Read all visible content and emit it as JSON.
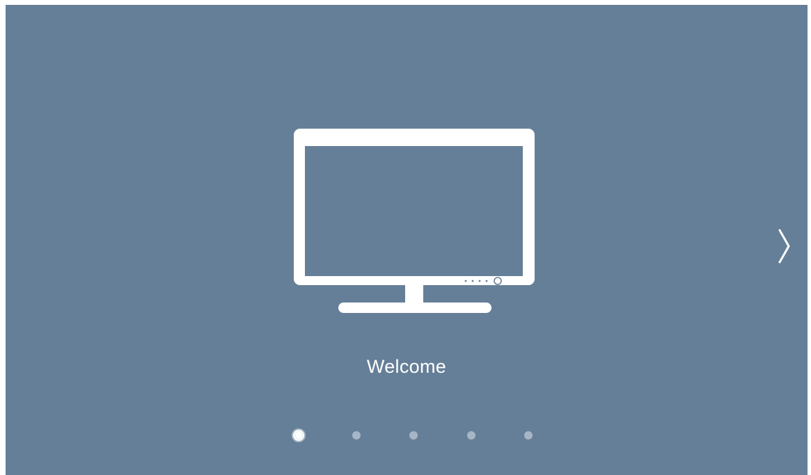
{
  "colors": {
    "background": "#667f98",
    "foreground": "#ffffff",
    "dot_inactive": "#a6b6c6"
  },
  "icon": "monitor-icon",
  "next_icon": "chevron-right-icon",
  "title": "Welcome",
  "pager": {
    "total": 5,
    "current": 1
  }
}
